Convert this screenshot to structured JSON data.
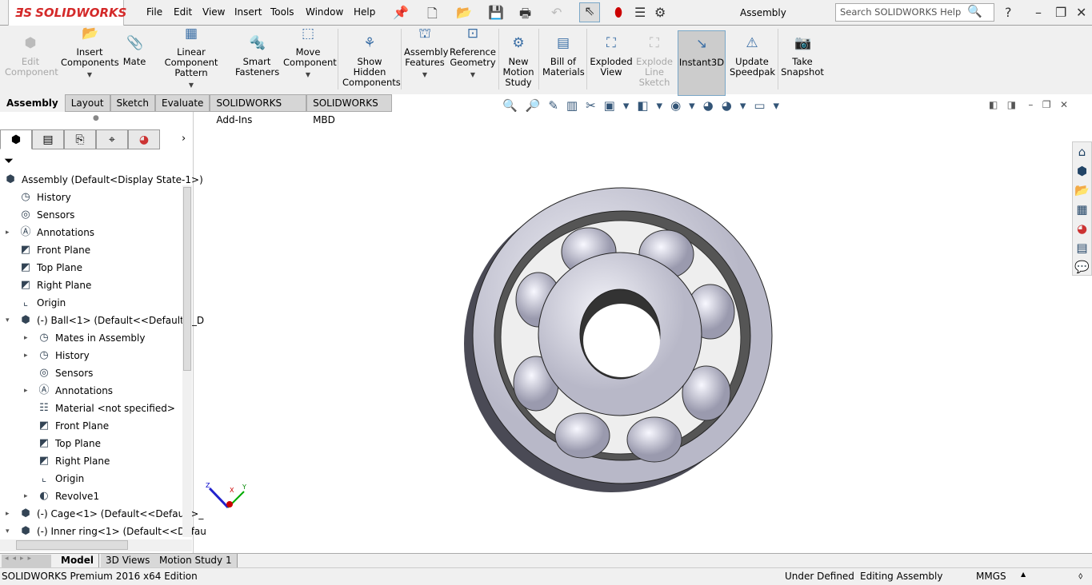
{
  "app": {
    "logo": "SOLIDWORKS",
    "title": "Assembly",
    "search_placeholder": "Search SOLIDWORKS Help"
  },
  "menu": [
    "File",
    "Edit",
    "View",
    "Insert",
    "Tools",
    "Window",
    "Help"
  ],
  "ribbon": [
    {
      "label": "Edit Component",
      "icon": "edit-component-icon",
      "disabled": true
    },
    {
      "label": "Insert Components",
      "icon": "insert-components-icon"
    },
    {
      "label": "Mate",
      "icon": "paperclip-icon"
    },
    {
      "label": "Linear Component Pattern",
      "icon": "pattern-icon"
    },
    {
      "label": "Smart Fasteners",
      "icon": "fastener-icon"
    },
    {
      "label": "Move Component",
      "icon": "move-icon"
    },
    {
      "label": "Show Hidden Components",
      "icon": "show-hidden-icon"
    },
    {
      "label": "Assembly Features",
      "icon": "assembly-features-icon"
    },
    {
      "label": "Reference Geometry",
      "icon": "reference-geometry-icon"
    },
    {
      "label": "New Motion Study",
      "icon": "motion-study-icon"
    },
    {
      "label": "Bill of Materials",
      "icon": "bom-icon"
    },
    {
      "label": "Exploded View",
      "icon": "exploded-view-icon"
    },
    {
      "label": "Explode Line Sketch",
      "icon": "explode-line-icon",
      "disabled": true
    },
    {
      "label": "Instant3D",
      "icon": "instant3d-icon",
      "active": true
    },
    {
      "label": "Update Speedpak",
      "icon": "speedpak-icon"
    },
    {
      "label": "Take Snapshot",
      "icon": "camera-icon"
    }
  ],
  "tabs": [
    "Assembly",
    "Layout",
    "Sketch",
    "Evaluate",
    "SOLIDWORKS Add-Ins",
    "SOLIDWORKS MBD"
  ],
  "tree": [
    {
      "label": "Assembly  (Default<Display State-1>)",
      "level": 0
    },
    {
      "label": "History",
      "level": 1
    },
    {
      "label": "Sensors",
      "level": 1
    },
    {
      "label": "Annotations",
      "level": 1,
      "expand": true
    },
    {
      "label": "Front Plane",
      "level": 1
    },
    {
      "label": "Top Plane",
      "level": 1
    },
    {
      "label": "Right Plane",
      "level": 1
    },
    {
      "label": "Origin",
      "level": 1
    },
    {
      "label": "(-) Ball<1> (Default<<Default>_D",
      "level": 1,
      "expand": "open"
    },
    {
      "label": "Mates in Assembly",
      "level": 2,
      "expand": true
    },
    {
      "label": "History",
      "level": 2,
      "expand": true
    },
    {
      "label": "Sensors",
      "level": 2
    },
    {
      "label": "Annotations",
      "level": 2,
      "expand": true
    },
    {
      "label": "Material <not specified>",
      "level": 2
    },
    {
      "label": "Front Plane",
      "level": 2
    },
    {
      "label": "Top Plane",
      "level": 2
    },
    {
      "label": "Right Plane",
      "level": 2
    },
    {
      "label": "Origin",
      "level": 2
    },
    {
      "label": "Revolve1",
      "level": 2,
      "expand": true
    },
    {
      "label": "(-) Cage<1> (Default<<Default>_",
      "level": 1,
      "expand": true
    },
    {
      "label": "(-) Inner ring<1> (Default<<Defau",
      "level": 1,
      "expand": "open"
    }
  ],
  "bottom_tabs": [
    "Model",
    "3D Views",
    "Motion Study 1"
  ],
  "status": {
    "edition": "SOLIDWORKS Premium 2016 x64 Edition",
    "state": "Under Defined",
    "mode": "Editing Assembly",
    "units": "MMGS"
  },
  "triad": {
    "x": "X",
    "y": "Y",
    "z": "Z"
  }
}
